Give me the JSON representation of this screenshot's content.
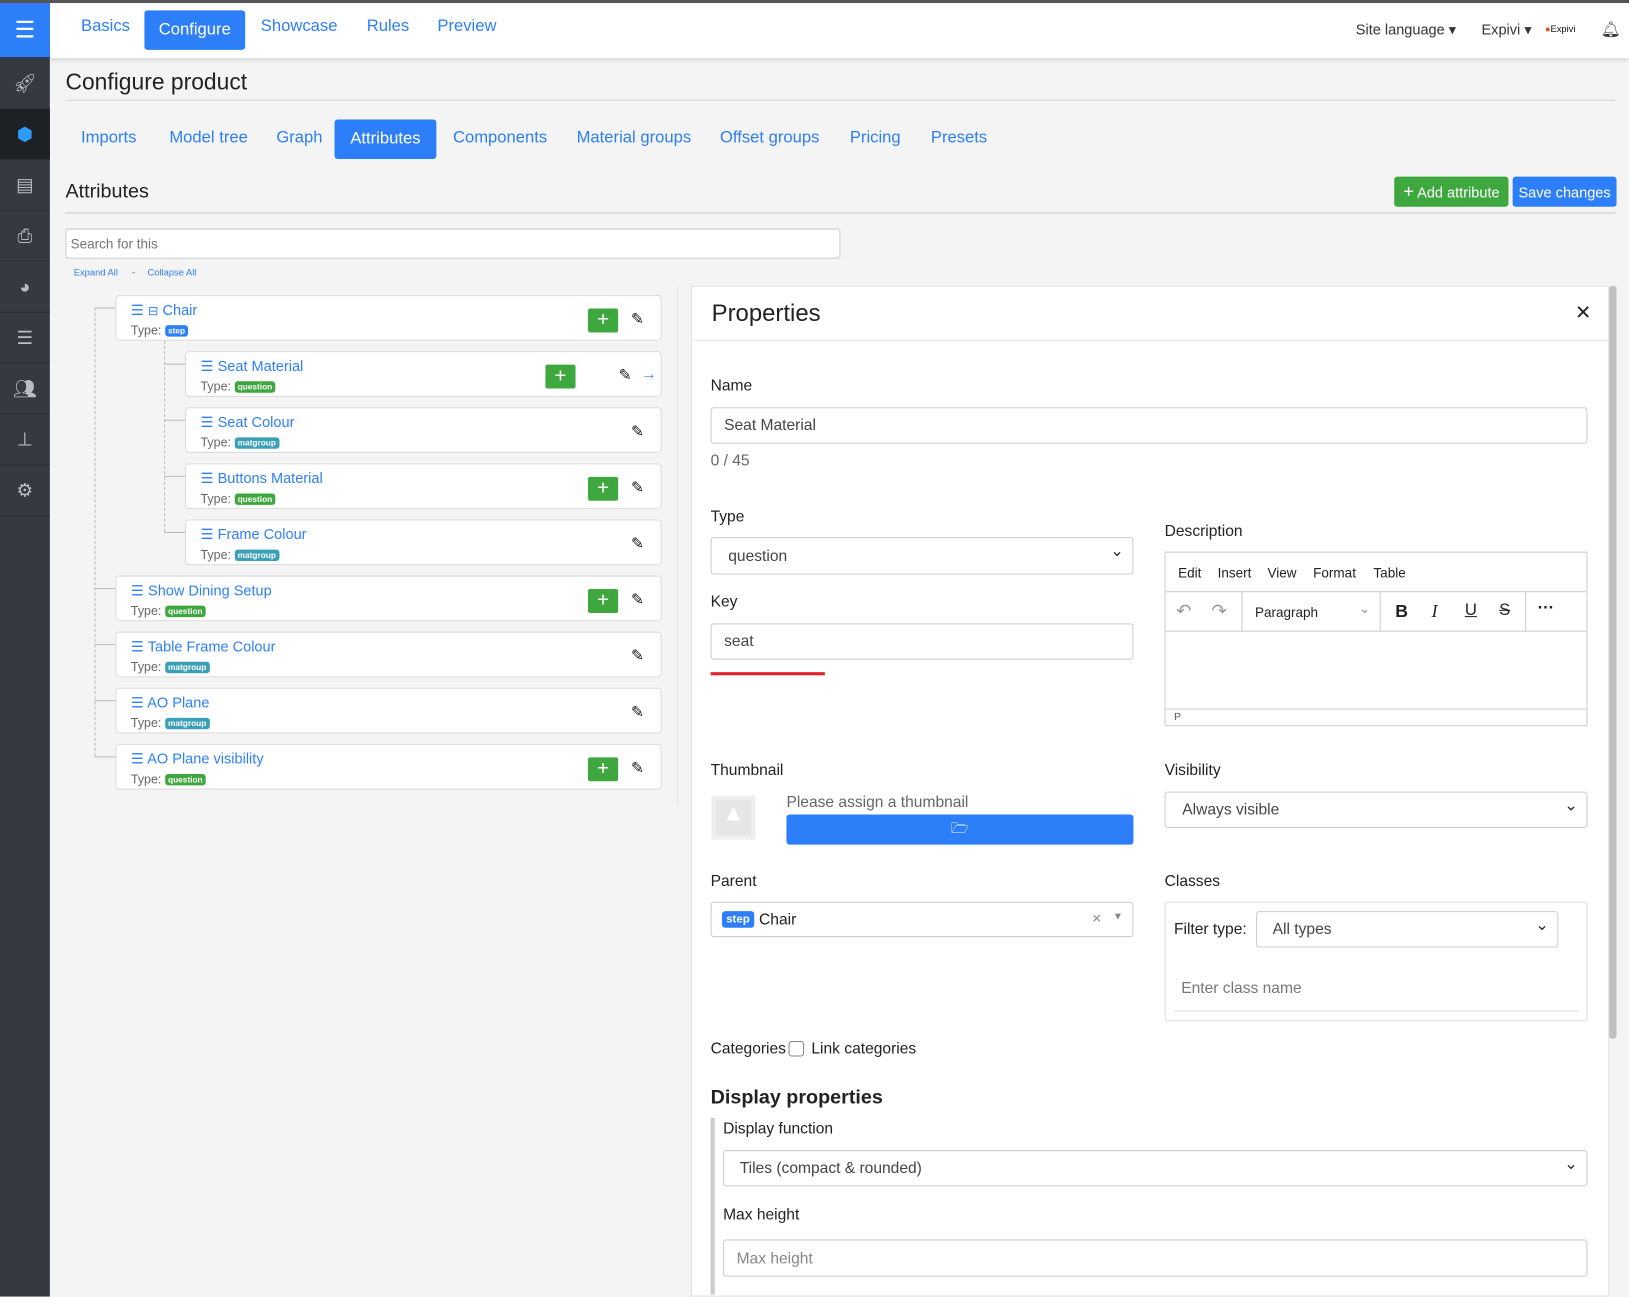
{
  "header": {
    "nav": [
      "Basics",
      "Configure",
      "Showcase",
      "Rules",
      "Preview"
    ],
    "active_nav": "Configure",
    "site_language": "Site language",
    "account": "Expivi",
    "logo_text": "Expivi"
  },
  "sidebar": {
    "icons": [
      "menu-icon",
      "rocket-icon",
      "cube-icon",
      "table-icon",
      "print-icon",
      "pie-chart-icon",
      "checklist-icon",
      "users-icon",
      "sitemap-icon",
      "settings-icon"
    ],
    "active": "cube-icon",
    "accent": "#2d7ff9"
  },
  "page": {
    "title": "Configure product",
    "tabs": [
      "Imports",
      "Model tree",
      "Graph",
      "Attributes",
      "Components",
      "Material groups",
      "Offset groups",
      "Pricing",
      "Presets"
    ],
    "active_tab": "Attributes"
  },
  "attributes": {
    "heading": "Attributes",
    "add_label": "Add attribute",
    "save_label": "Save changes",
    "search_placeholder": "Search for this",
    "expand_all": "Expand All",
    "separator": "-",
    "collapse_all": "Collapse All",
    "type_label": "Type:",
    "tree": [
      {
        "name": "Chair",
        "type": "step",
        "level": 0,
        "add": true
      },
      {
        "name": "Seat Material",
        "type": "question",
        "level": 1,
        "add": true,
        "selected": true
      },
      {
        "name": "Seat Colour",
        "type": "matgroup",
        "level": 1,
        "add": false
      },
      {
        "name": "Buttons Material",
        "type": "question",
        "level": 1,
        "add": true
      },
      {
        "name": "Frame Colour",
        "type": "matgroup",
        "level": 1,
        "add": false
      },
      {
        "name": "Show Dining Setup",
        "type": "question",
        "level": 0,
        "add": true
      },
      {
        "name": "Table Frame Colour",
        "type": "matgroup",
        "level": 0,
        "add": false
      },
      {
        "name": "AO Plane",
        "type": "matgroup",
        "level": 0,
        "add": false
      },
      {
        "name": "AO Plane visibility",
        "type": "question",
        "level": 0,
        "add": true
      }
    ]
  },
  "properties": {
    "title": "Properties",
    "name_label": "Name",
    "name_value": "Seat Material",
    "name_counter": "0 / 45",
    "type_label": "Type",
    "type_value": "question",
    "key_label": "Key",
    "key_value": "seat",
    "description_label": "Description",
    "editor_menu": [
      "Edit",
      "Insert",
      "View",
      "Format",
      "Table"
    ],
    "editor_block": "Paragraph",
    "editor_status": "P",
    "thumbnail_label": "Thumbnail",
    "thumbnail_hint": "Please assign a thumbnail",
    "visibility_label": "Visibility",
    "visibility_value": "Always visible",
    "parent_label": "Parent",
    "parent_badge": "step",
    "parent_value": "Chair",
    "classes_label": "Classes",
    "filter_type_label": "Filter type:",
    "filter_type_value": "All types",
    "class_placeholder": "Enter class name",
    "categories_label": "Categories",
    "link_categories": "Link categories",
    "display_heading": "Display properties",
    "display_function_label": "Display function",
    "display_function_value": "Tiles (compact & rounded)",
    "max_height_label": "Max height",
    "max_height_placeholder": "Max height"
  }
}
